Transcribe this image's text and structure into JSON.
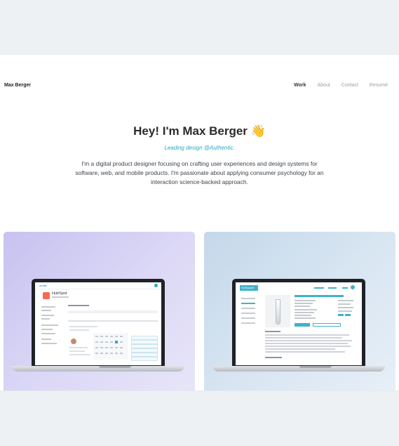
{
  "brand": "Max Berger",
  "nav": {
    "work": "Work",
    "about": "About",
    "contact": "Contact",
    "resume": "Resumé"
  },
  "hero": {
    "title": "Hey! I'm Max Berger",
    "wave": "👋",
    "subtitle": "Leading design @Authentic.",
    "description": "I'm a digital product designer focusing on crafting user experiences and design systems for software, web, and mobile products. I'm passionate about applying consumer psychology for an interaction science-backed approach."
  },
  "projects": [
    {
      "screen_logo": "HubSpot",
      "app": "vendr"
    },
    {
      "screen_logo": "SciSquare"
    }
  ],
  "colors": {
    "accent": "#23a9c7",
    "card_left": "#d6d2f4",
    "card_right": "#d6e4f1"
  }
}
